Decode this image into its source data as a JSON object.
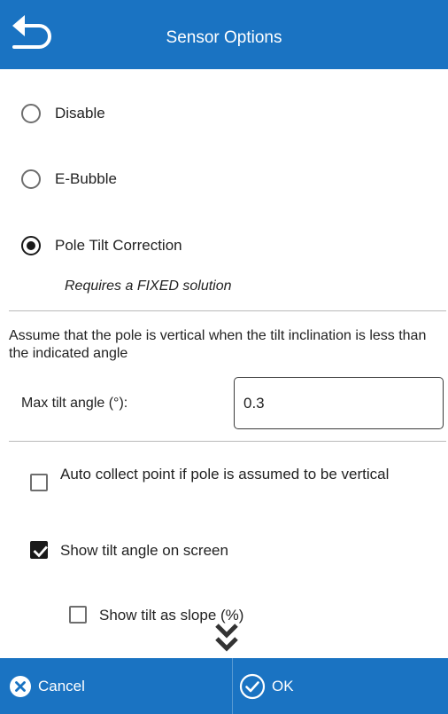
{
  "header": {
    "title": "Sensor Options",
    "back_icon": "back-arrow-icon"
  },
  "tilt_mode": {
    "options": [
      {
        "label": "Disable",
        "checked": false
      },
      {
        "label": "E-Bubble",
        "checked": false
      },
      {
        "label": "Pole Tilt Correction",
        "checked": true
      }
    ],
    "note": "Requires a FIXED solution"
  },
  "assume_vertical": {
    "description": "Assume that the pole is vertical when the tilt inclination is less than the indicated angle",
    "max_tilt_label": "Max tilt angle (°):",
    "max_tilt_value": "0.3"
  },
  "checkboxes": [
    {
      "label": "Auto collect point if pole is assumed to be vertical",
      "checked": false
    },
    {
      "label": "Show tilt angle on screen",
      "checked": true
    },
    {
      "label": "Show tilt as slope (%)",
      "checked": false
    }
  ],
  "footer": {
    "cancel_label": "Cancel",
    "ok_label": "OK"
  },
  "colors": {
    "accent": "#1a73c2",
    "text": "#222222"
  }
}
